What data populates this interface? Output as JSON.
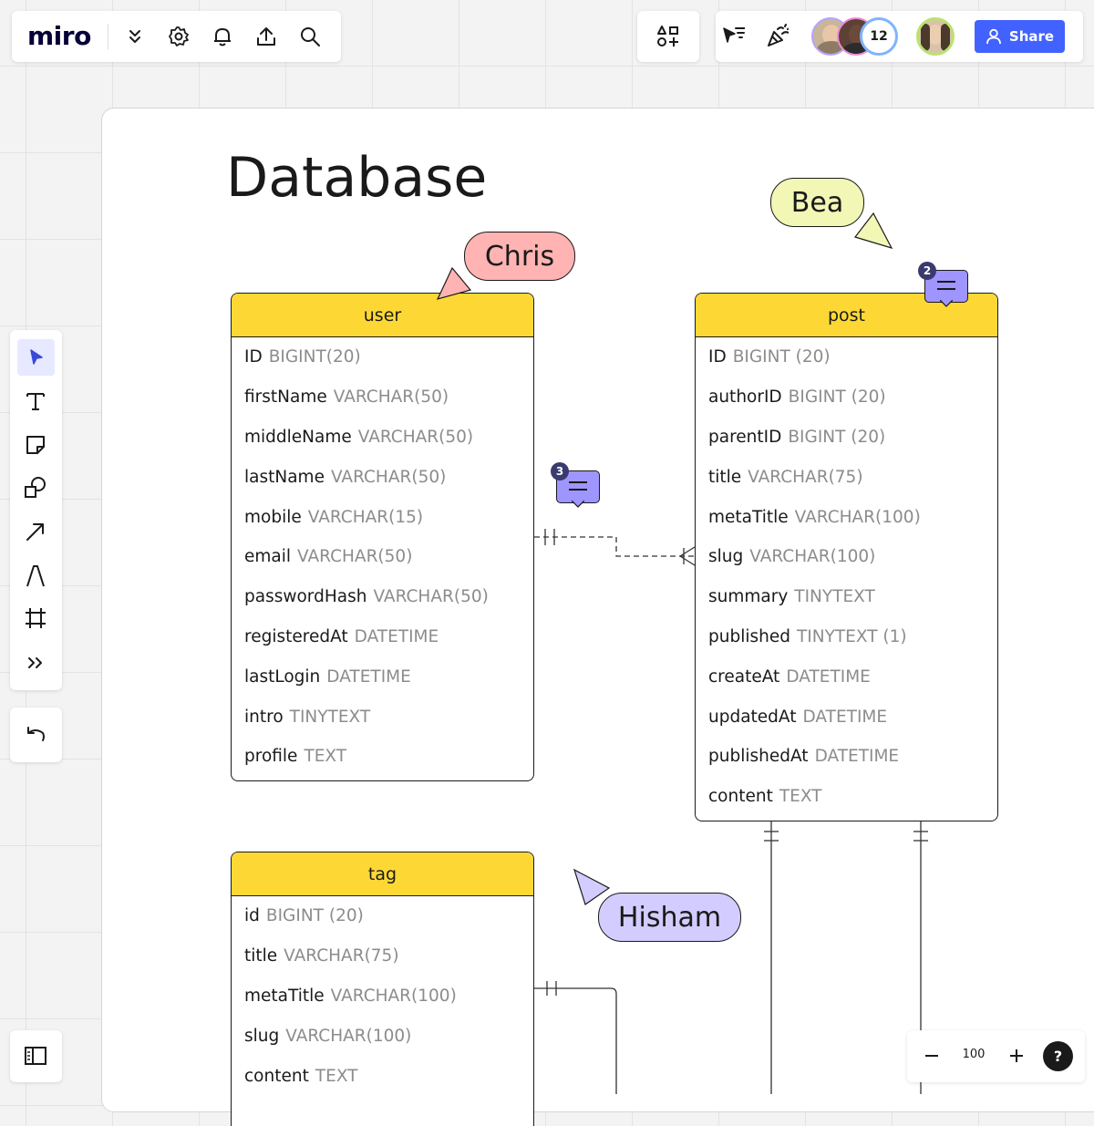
{
  "app": {
    "logo": "miro",
    "toolbar_icons": [
      "chevrons-down-icon",
      "gear-icon",
      "bell-icon",
      "upload-icon",
      "search-icon"
    ],
    "share_label": "Share",
    "collaborator_count": "12",
    "zoom": "100",
    "help": "?"
  },
  "board": {
    "title": "Database",
    "cursors": [
      {
        "name": "Chris",
        "color": "#ffb3b3"
      },
      {
        "name": "Bea",
        "color": "#f2f7b5"
      },
      {
        "name": "Hisham",
        "color": "#d3ccff"
      }
    ],
    "comments": [
      {
        "count": "3"
      },
      {
        "count": "2"
      }
    ]
  },
  "tables": {
    "user": {
      "name": "user",
      "fields": [
        {
          "name": "ID",
          "type": "BIGINT(20)"
        },
        {
          "name": "firstName",
          "type": "VARCHAR(50)"
        },
        {
          "name": "middleName",
          "type": "VARCHAR(50)"
        },
        {
          "name": "lastName",
          "type": "VARCHAR(50)"
        },
        {
          "name": "mobile",
          "type": "VARCHAR(15)"
        },
        {
          "name": "email",
          "type": "VARCHAR(50)"
        },
        {
          "name": "passwordHash",
          "type": "VARCHAR(50)"
        },
        {
          "name": "registeredAt",
          "type": "DATETIME"
        },
        {
          "name": "lastLogin",
          "type": "DATETIME"
        },
        {
          "name": "intro",
          "type": "TINYTEXT"
        },
        {
          "name": "profile",
          "type": "TEXT"
        }
      ]
    },
    "post": {
      "name": "post",
      "fields": [
        {
          "name": "ID",
          "type": "BIGINT (20)"
        },
        {
          "name": "authorID",
          "type": "BIGINT (20)"
        },
        {
          "name": "parentID",
          "type": "BIGINT (20)"
        },
        {
          "name": "title",
          "type": "VARCHAR(75)"
        },
        {
          "name": "metaTitle",
          "type": "VARCHAR(100)"
        },
        {
          "name": "slug",
          "type": "VARCHAR(100)"
        },
        {
          "name": "summary",
          "type": "TINYTEXT"
        },
        {
          "name": "published",
          "type": "TINYTEXT (1)"
        },
        {
          "name": "createAt",
          "type": "DATETIME"
        },
        {
          "name": "updatedAt",
          "type": "DATETIME"
        },
        {
          "name": "publishedAt",
          "type": "DATETIME"
        },
        {
          "name": "content",
          "type": "TEXT"
        }
      ]
    },
    "tag": {
      "name": "tag",
      "fields": [
        {
          "name": "id",
          "type": "BIGINT (20)"
        },
        {
          "name": "title",
          "type": "VARCHAR(75)"
        },
        {
          "name": "metaTitle",
          "type": "VARCHAR(100)"
        },
        {
          "name": "slug",
          "type": "VARCHAR(100)"
        },
        {
          "name": "content",
          "type": "TEXT"
        }
      ]
    }
  },
  "colors": {
    "header_yellow": "#fdd835",
    "accent_blue": "#4262ff",
    "comment_purple": "#9f95ff"
  }
}
